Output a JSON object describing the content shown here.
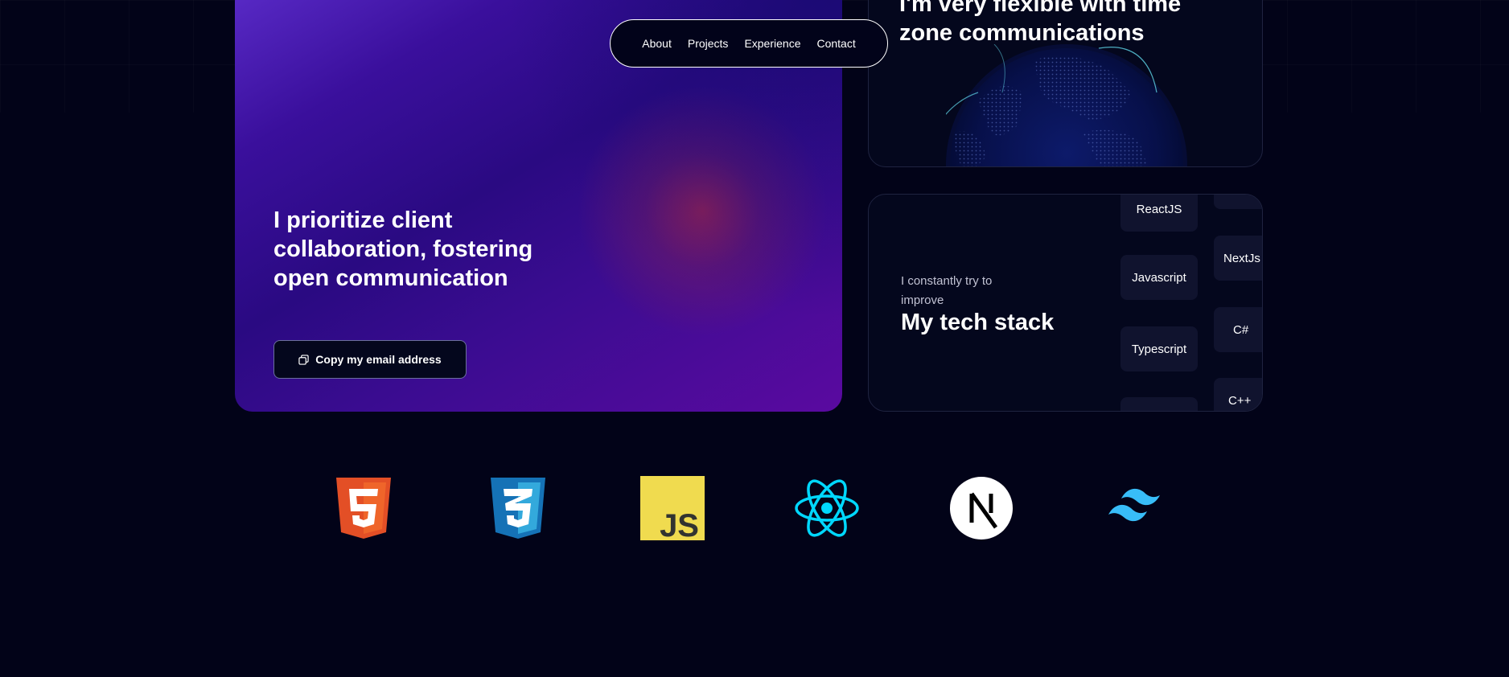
{
  "nav": {
    "links": [
      "About",
      "Projects",
      "Experience",
      "Contact"
    ]
  },
  "collab_card": {
    "title": "I prioritize client collaboration, fostering open communication",
    "copy_button_label": "Copy my email address",
    "copy_icon": "copy-icon"
  },
  "timezone_card": {
    "title": "I'm very flexible with time zone communications",
    "graphic": "globe-icon"
  },
  "tech_card": {
    "subtitle": "I constantly try to improve",
    "title": "My tech stack",
    "chips_col1": [
      "ReactJS",
      "Javascript",
      "Typescript",
      ""
    ],
    "chips_col2": [
      "",
      "NextJs",
      "C#",
      "C++"
    ]
  },
  "logos": [
    {
      "name": "html5-logo",
      "color": "#e34f26"
    },
    {
      "name": "css3-logo",
      "color": "#1572b6"
    },
    {
      "name": "javascript-logo",
      "color": "#f0db4f",
      "text": "JS"
    },
    {
      "name": "react-logo",
      "color": "#00d8ff"
    },
    {
      "name": "nextjs-logo",
      "color": "#ffffff",
      "text": "N"
    },
    {
      "name": "tailwind-logo",
      "color": "#38bdf8"
    }
  ],
  "colors": {
    "background": "#020318",
    "card": "#04071d",
    "chip": "#10132e",
    "accent_purple": "#3a0f9c"
  }
}
